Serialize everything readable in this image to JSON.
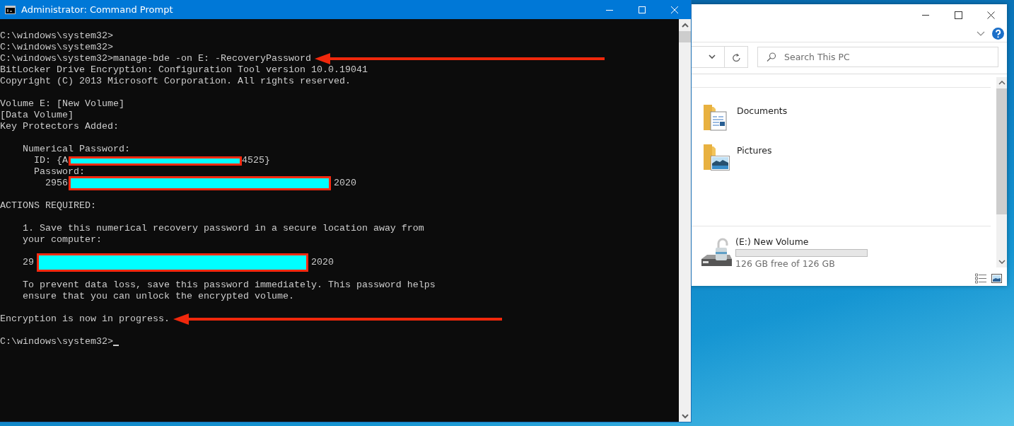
{
  "console_window": {
    "title": "Administrator: Command Prompt",
    "lines": [
      {
        "kind": "blank"
      },
      {
        "kind": "text",
        "text": "C:\\windows\\system32>"
      },
      {
        "kind": "text",
        "text": "C:\\windows\\system32>"
      },
      {
        "kind": "text",
        "text": "C:\\windows\\system32>manage-bde -on E: -RecoveryPassword",
        "arrow": true
      },
      {
        "kind": "text",
        "text": "BitLocker Drive Encryption: Configuration Tool version 10.0.19041"
      },
      {
        "kind": "text",
        "text": "Copyright (C) 2013 Microsoft Corporation. All rights reserved."
      },
      {
        "kind": "blank"
      },
      {
        "kind": "text",
        "text": "Volume E: [New Volume]"
      },
      {
        "kind": "text",
        "text": "[Data Volume]"
      },
      {
        "kind": "text",
        "text": "Key Protectors Added:"
      },
      {
        "kind": "blank"
      },
      {
        "kind": "text",
        "text": "    Numerical Password:"
      },
      {
        "kind": "redacted",
        "before": "      ID: {A",
        "after": "4525}"
      },
      {
        "kind": "text",
        "text": "      Password:"
      },
      {
        "kind": "redacted",
        "before": "        2956",
        "after": "2020"
      },
      {
        "kind": "blank"
      },
      {
        "kind": "text",
        "text": "ACTIONS REQUIRED:"
      },
      {
        "kind": "blank"
      },
      {
        "kind": "text",
        "text": "    1. Save this numerical recovery password in a secure location away from"
      },
      {
        "kind": "text",
        "text": "    your computer:"
      },
      {
        "kind": "blank"
      },
      {
        "kind": "redacted",
        "before": "    29",
        "after": "2020"
      },
      {
        "kind": "blank"
      },
      {
        "kind": "text",
        "text": "    To prevent data loss, save this password immediately. This password helps"
      },
      {
        "kind": "text",
        "text": "    ensure that you can unlock the encrypted volume."
      },
      {
        "kind": "blank"
      },
      {
        "kind": "text",
        "text": "Encryption is now in progress.",
        "arrow": true
      },
      {
        "kind": "blank"
      },
      {
        "kind": "prompt",
        "text": "C:\\windows\\system32>",
        "cursor": true
      }
    ]
  },
  "explorer_window": {
    "search": {
      "placeholder": "Search This PC"
    },
    "folders": [
      {
        "name": "Documents",
        "kind": "documents"
      },
      {
        "name": "Pictures",
        "kind": "pictures"
      }
    ],
    "drives": [
      {
        "name": "(E:) New Volume",
        "level": 0,
        "free_space": "126 GB free of 126 GB"
      }
    ]
  }
}
